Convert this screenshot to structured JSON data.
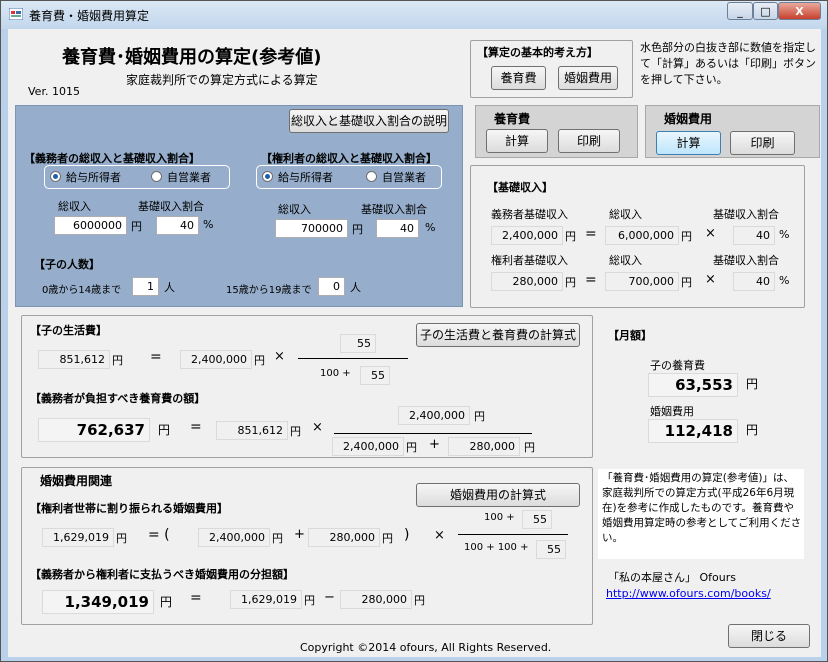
{
  "window": {
    "title": "養育費・婚姻費用算定",
    "min": "_",
    "max": "□",
    "close": "X"
  },
  "header": {
    "title": "養育費･婚姻費用の算定(参考値)",
    "subtitle": "家庭裁判所での算定方式による算定",
    "version": "Ver. 1015"
  },
  "basic": {
    "title": "【算定の基本的考え方】",
    "child_btn": "養育費",
    "marriage_btn": "婚姻費用"
  },
  "instruction": "水色部分の白抜き部に数値を指定して「計算」あるいは「印刷」ボタンを押して下さい。",
  "child_panel": {
    "title": "養育費",
    "calc": "計算",
    "print": "印刷"
  },
  "marriage_panel": {
    "title": "婚姻費用",
    "calc": "計算",
    "print": "印刷"
  },
  "input": {
    "explain_btn": "総収入と基礎収入割合の説明",
    "obligor": {
      "title": "【義務者の総収入と基礎収入割合】",
      "radio1": "給与所得者",
      "radio2": "自営業者",
      "income_label": "総収入",
      "ratio_label": "基礎収入割合",
      "income": "6000000",
      "ratio": "40",
      "yen": "円",
      "pct": "%"
    },
    "obligee": {
      "title": "【権利者の総収入と基礎収入割合】",
      "radio1": "給与所得者",
      "radio2": "自営業者",
      "income_label": "総収入",
      "ratio_label": "基礎収入割合",
      "income": "700000",
      "ratio": "40",
      "yen": "円",
      "pct": "%"
    },
    "children": {
      "title": "【子の人数】",
      "age1_label": "0歳から14歳まで",
      "age1": "1",
      "age2_label": "15歳から19歳まで",
      "age2": "0",
      "unit": "人"
    }
  },
  "basic_income": {
    "title": "【基礎収入】",
    "row1": {
      "label": "義務者基礎収入",
      "income_label": "総収入",
      "ratio_label": "基礎収入割合",
      "value": "2,400,000",
      "income": "6,000,000",
      "ratio": "40"
    },
    "row2": {
      "label": "権利者基礎収入",
      "income_label": "総収入",
      "ratio_label": "基礎収入割合",
      "value": "280,000",
      "income": "700,000",
      "ratio": "40"
    },
    "yen": "円",
    "eq": "=",
    "times": "×",
    "pct": "%"
  },
  "living": {
    "title": "【子の生活費】",
    "formula_btn": "子の生活費と養育費の計算式",
    "value": "851,612",
    "base": "2,400,000",
    "num": "55",
    "den_prefix": "100 +",
    "den": "55",
    "yen": "円",
    "eq": "=",
    "times": "×"
  },
  "child_support": {
    "title": "【義務者が負担すべき養育費の額】",
    "value": "762,637",
    "living": "851,612",
    "num": "2,400,000",
    "den1": "2,400,000",
    "den2": "280,000",
    "yen": "円",
    "eq": "=",
    "times": "×",
    "plus": "+"
  },
  "monthly": {
    "title": "【月額】",
    "child_label": "子の養育費",
    "child_value": "63,553",
    "marriage_label": "婚姻費用",
    "marriage_value": "112,418",
    "yen": "円"
  },
  "marriage": {
    "title": "婚姻費用関連",
    "formula_btn": "婚姻費用の計算式",
    "alloc_title": "【権利者世帯に割り振られる婚姻費用】",
    "alloc_value": "1,629,019",
    "a": "2,400,000",
    "b": "280,000",
    "num_prefix": "100 +",
    "num": "55",
    "den_prefix": "100 +  100 +",
    "den": "55",
    "share_title": "【義務者から権利者に支払うべき婚姻費用の分担額】",
    "share_value": "1,349,019",
    "share_a": "1,629,019",
    "share_b": "280,000",
    "yen": "円",
    "eq": "=",
    "open": "=  (",
    "close": ")",
    "times": "×",
    "plus": "+",
    "minus": "−"
  },
  "note": "「養育費･婚姻費用の算定(参考値)」は、家庭裁判所での算定方式(平成26年6月現在)を参考に作成したものです。養育費や婚姻費用算定時の参考としてご利用ください。",
  "publisher": "「私の本屋さん」 Ofours",
  "url": "http://www.ofours.com/books/",
  "close_btn": "閉じる",
  "copyright": "Copyright ©2014 ofours, All Rights Reserved."
}
